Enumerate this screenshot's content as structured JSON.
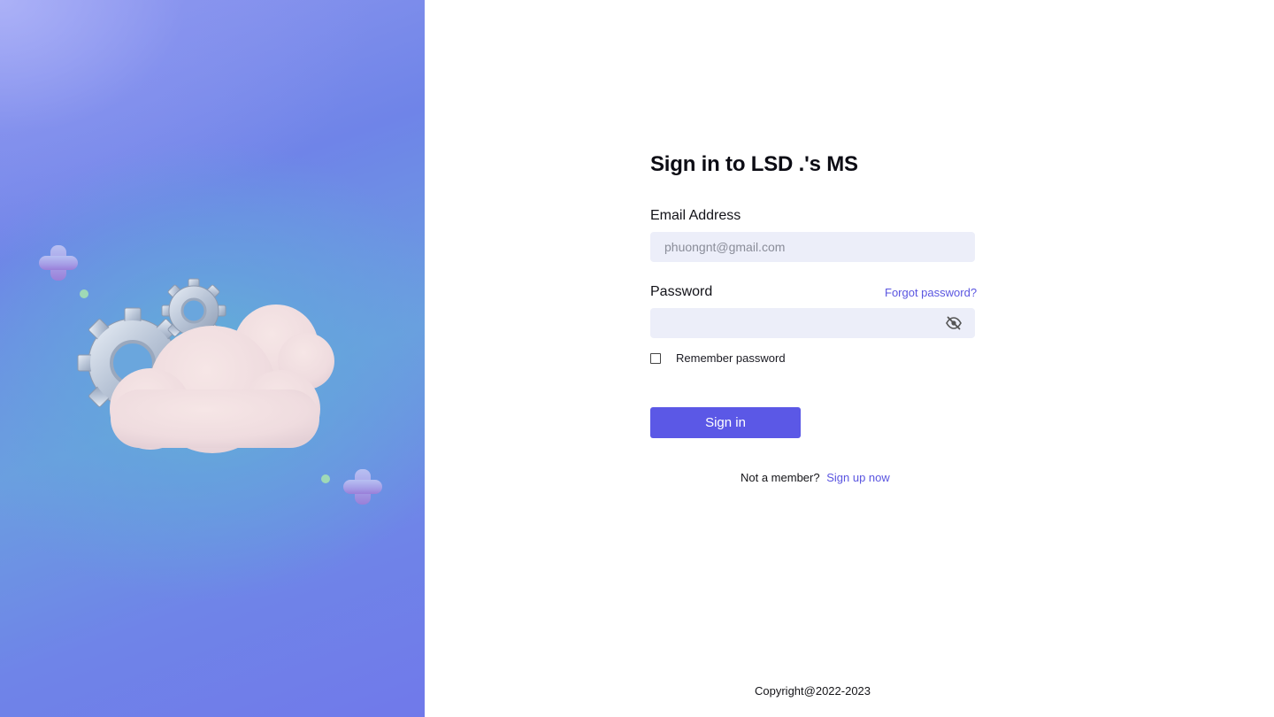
{
  "hero": {
    "illustration": [
      "plus-shape",
      "gear-icon",
      "cloud-shape"
    ]
  },
  "form": {
    "title": "Sign in to LSD .'s MS",
    "email": {
      "label": "Email Address",
      "placeholder": "phuongnt@gmail.com",
      "value": ""
    },
    "password": {
      "label": "Password",
      "forgot_label": "Forgot password?",
      "value": "",
      "toggle_icon": "eye-off-icon"
    },
    "remember": {
      "label": "Remember password",
      "checked": false
    },
    "submit_label": "Sign in",
    "signup": {
      "prompt": "Not a member?",
      "link_label": "Sign up now"
    }
  },
  "footer": {
    "copyright": "Copyright@2022-2023"
  },
  "colors": {
    "accent": "#5b58e6",
    "link": "#5a55e0",
    "input_bg": "#eceef9",
    "hero_gradient_start": "#8e98ef",
    "hero_gradient_end": "#6f84e8"
  }
}
